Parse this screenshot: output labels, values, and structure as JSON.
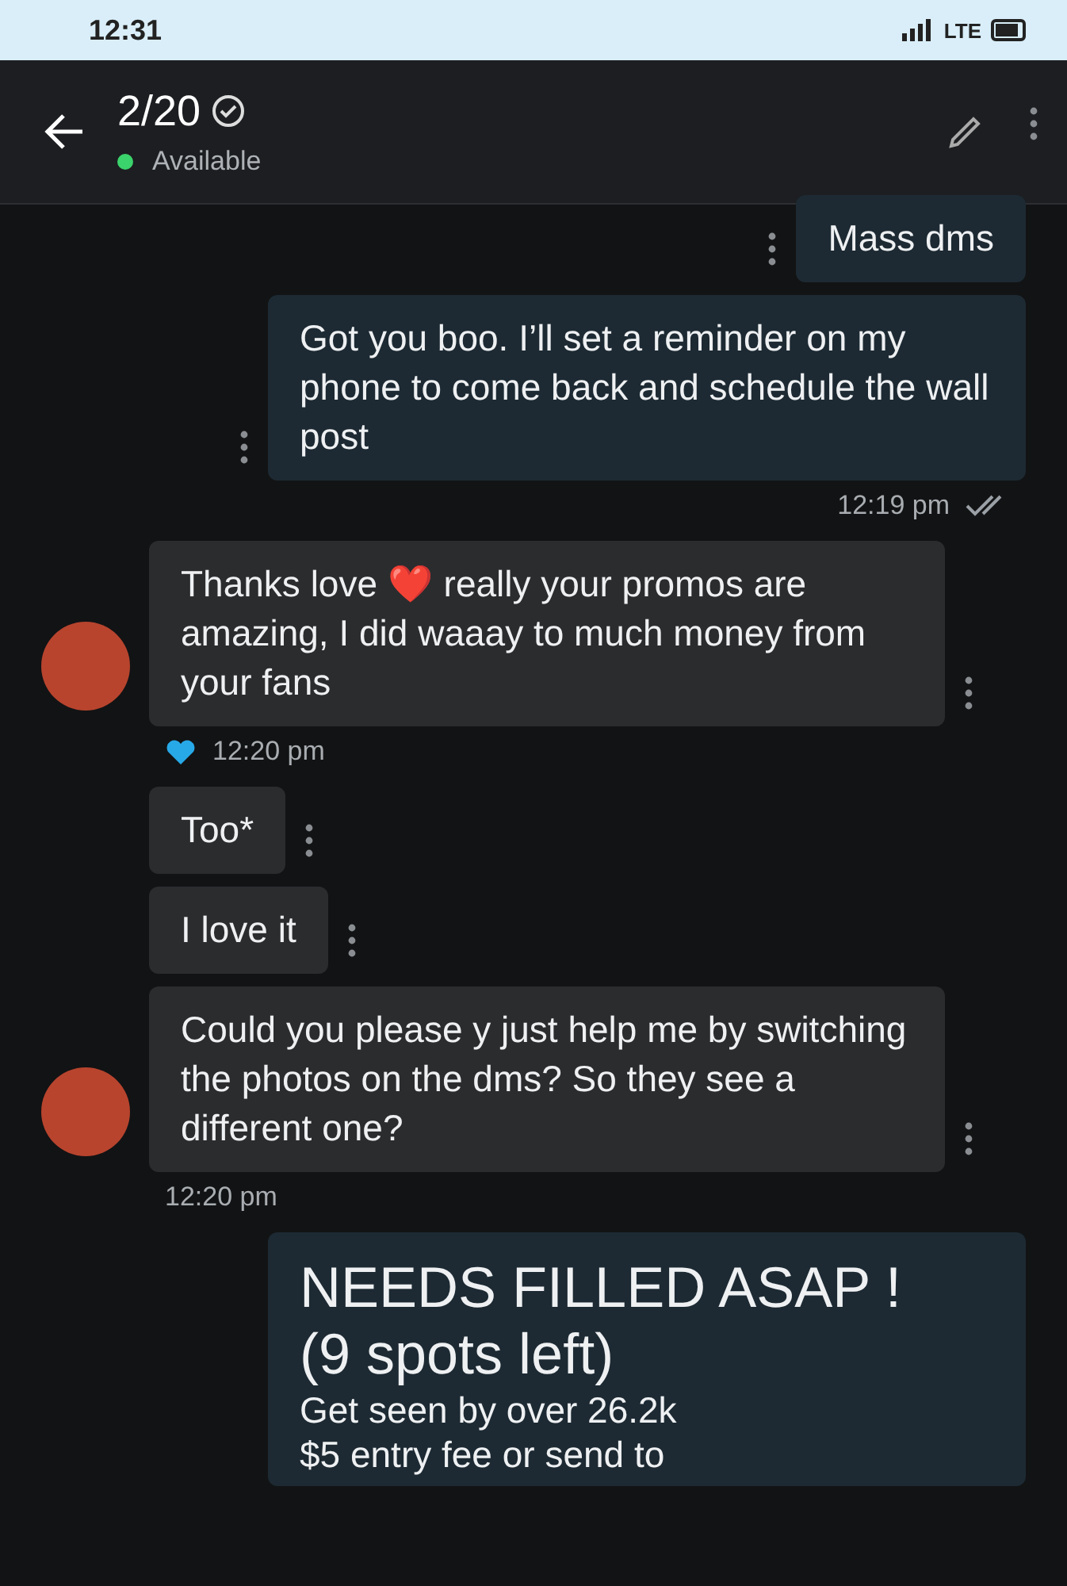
{
  "status_bar": {
    "time": "12:31",
    "network": "LTE"
  },
  "header": {
    "title": "2/20",
    "verified": true,
    "status": "Available",
    "online": true
  },
  "messages": [
    {
      "kind": "sent",
      "text": "Mass dms"
    },
    {
      "kind": "sent",
      "text": "Got you boo. I’ll set a reminder on my phone to come back and schedule the wall post",
      "time": "12:19 pm",
      "read": true
    },
    {
      "kind": "received",
      "text": "Thanks love ❤️ really your promos are amazing, I did waaay to much money from your fans",
      "time": "12:20 pm",
      "liked": true,
      "avatar": true
    },
    {
      "kind": "received",
      "text": "Too*"
    },
    {
      "kind": "received",
      "text": "I love it"
    },
    {
      "kind": "received",
      "text": "Could you please y just help me by switching the photos on the dms? So they see a different one?",
      "time": "12:20 pm",
      "avatar": true
    },
    {
      "kind": "promo",
      "lines": [
        {
          "kind": "large",
          "text": "NEEDS FILLED ASAP !"
        },
        {
          "kind": "large",
          "text": "(9 spots left)"
        },
        {
          "kind": "small",
          "text": "Get seen by over 26.2k"
        },
        {
          "kind": "small",
          "text": "$5 entry fee or send to"
        }
      ]
    }
  ]
}
